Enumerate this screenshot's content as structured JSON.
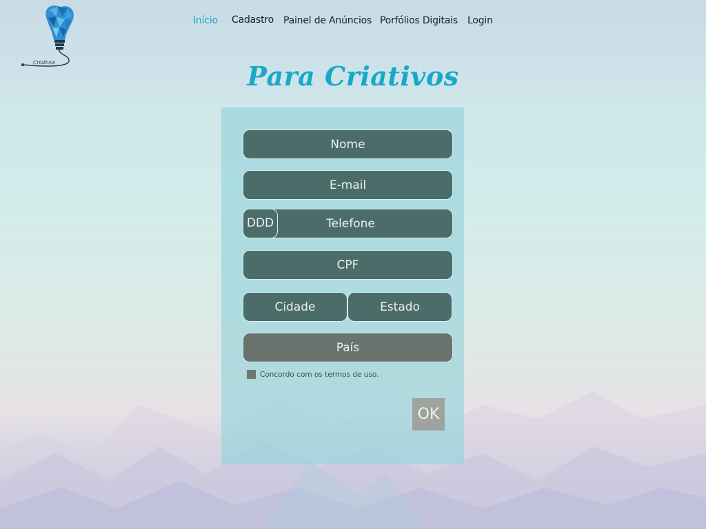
{
  "logo": {
    "caption": "Criativos"
  },
  "nav": {
    "items": [
      {
        "label": "Início"
      },
      {
        "label": "Cadastro"
      },
      {
        "label": "Painel de Anúncios"
      },
      {
        "label": "Porfólios Digitais"
      },
      {
        "label": "Login"
      }
    ],
    "active_color": "#1aa7c9"
  },
  "page": {
    "title": "Para Criativos"
  },
  "form": {
    "nome_placeholder": "Nome",
    "email_placeholder": "E-mail",
    "ddd_placeholder": "DDD",
    "telefone_placeholder": "Telefone",
    "cpf_placeholder": "CPF",
    "cidade_placeholder": "Cidade",
    "estado_placeholder": "Estado",
    "pais_placeholder": "País",
    "terms_label": "Concordo com os termos de uso.",
    "terms_checked": false,
    "submit_label": "OK"
  },
  "colors": {
    "accent": "#17a9c7",
    "field_bg": "#4c6c6a"
  }
}
